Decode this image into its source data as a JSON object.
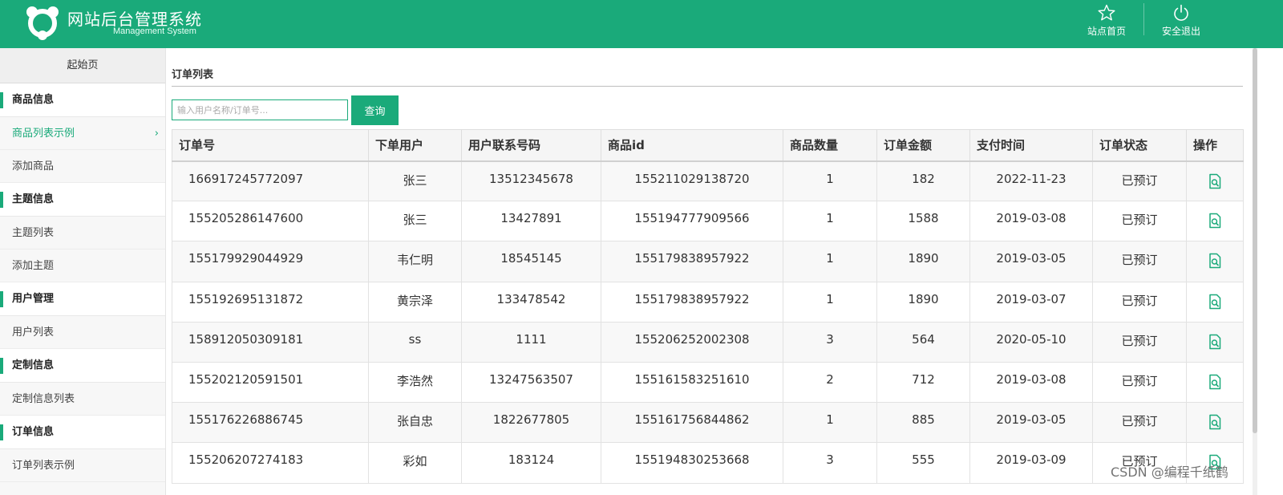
{
  "header": {
    "title": "网站后台管理系统",
    "subtitle": "Management System",
    "home_label": "站点首页",
    "logout_label": "安全退出"
  },
  "sidebar": {
    "start_label": "起始页",
    "groups": [
      {
        "title": "商品信息",
        "items": [
          "商品列表示例",
          "添加商品"
        ]
      },
      {
        "title": "主题信息",
        "items": [
          "主题列表",
          "添加主题"
        ]
      },
      {
        "title": "用户管理",
        "items": [
          "用户列表"
        ]
      },
      {
        "title": "定制信息",
        "items": [
          "定制信息列表"
        ]
      },
      {
        "title": "订单信息",
        "items": [
          "订单列表示例"
        ]
      }
    ],
    "active_item": "商品列表示例"
  },
  "main": {
    "page_title": "订单列表",
    "search": {
      "placeholder": "输入用户名称/订单号...",
      "value": "",
      "button_label": "查询"
    },
    "table": {
      "columns": [
        "订单号",
        "下单用户",
        "用户联系号码",
        "商品id",
        "商品数量",
        "订单金额",
        "支付时间",
        "订单状态",
        "操作"
      ],
      "rows": [
        [
          "166917245772097",
          "张三",
          "13512345678",
          "155211029138720",
          "1",
          "182",
          "2022-11-23",
          "已预订"
        ],
        [
          "155205286147600",
          "张三",
          "13427891",
          "155194777909566",
          "1",
          "1588",
          "2019-03-08",
          "已预订"
        ],
        [
          "155179929044929",
          "韦仁明",
          "18545145",
          "155179838957922",
          "1",
          "1890",
          "2019-03-05",
          "已预订"
        ],
        [
          "155192695131872",
          "黄宗泽",
          "133478542",
          "155179838957922",
          "1",
          "1890",
          "2019-03-07",
          "已预订"
        ],
        [
          "158912050309181",
          "ss",
          "1111",
          "155206252002308",
          "3",
          "564",
          "2020-05-10",
          "已预订"
        ],
        [
          "155202120591501",
          "李浩然",
          "13247563507",
          "155161583251610",
          "2",
          "712",
          "2019-03-08",
          "已预订"
        ],
        [
          "155176226886745",
          "张自忠",
          "1822677805",
          "155161756844862",
          "1",
          "885",
          "2019-03-05",
          "已预订"
        ],
        [
          "155206207274183",
          "彩如",
          "183124",
          "155194830253668",
          "3",
          "555",
          "2019-03-09",
          "已预订"
        ]
      ],
      "action_icon": "view-detail-icon"
    }
  },
  "watermark": "CSDN @编程千纸鹤",
  "colors": {
    "accent": "#1aaa7a"
  }
}
